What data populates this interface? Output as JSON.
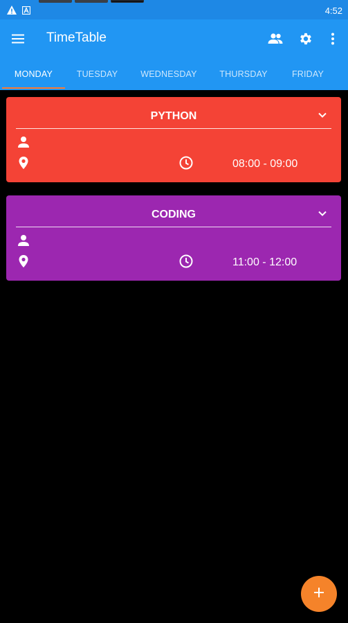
{
  "status_bar": {
    "time": "4:52",
    "icons": [
      "warning-icon",
      "app-notification-icon"
    ]
  },
  "toolbar": {
    "title": "TimeTable",
    "menu_icon": "menu-icon",
    "actions": [
      "teachers-icon",
      "settings-icon",
      "more-vert-icon"
    ]
  },
  "tabs": [
    {
      "label": "MONDAY",
      "active": true
    },
    {
      "label": "TUESDAY",
      "active": false
    },
    {
      "label": "WEDNESDAY",
      "active": false
    },
    {
      "label": "THURSDAY",
      "active": false
    },
    {
      "label": "FRIDAY",
      "active": false
    }
  ],
  "cards": [
    {
      "subject": "PYTHON",
      "teacher": "",
      "room": "",
      "time": "08:00 - 09:00",
      "color": "#f44336"
    },
    {
      "subject": "CODING",
      "teacher": "",
      "room": "",
      "time": "11:00 - 12:00",
      "color": "#9c27b0"
    }
  ],
  "fab": {
    "icon": "add-icon"
  },
  "colors": {
    "primary": "#2196f3",
    "primary_dark": "#1e88e5",
    "accent": "#f5832a",
    "background": "#000000"
  }
}
